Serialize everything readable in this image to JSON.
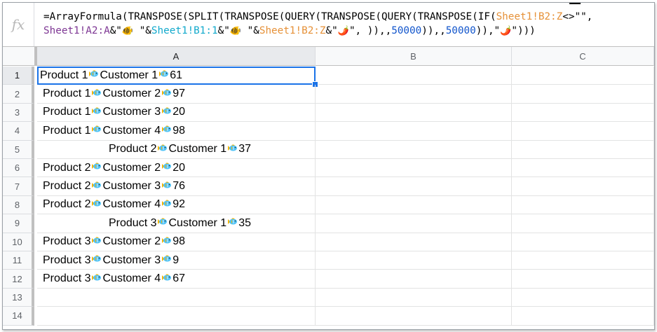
{
  "formula_bar": {
    "fx_label": "fx",
    "formula_segments": [
      {
        "t": "=ArrayFormula(TRANSPOSE(SPLIT(TRANSPOSE(QUERY(TRANSPOSE(QUERY(TRANSPOSE(IF(",
        "c": ""
      },
      {
        "t": "Sheet1!B2:Z",
        "c": "or"
      },
      {
        "t": "<>\"\",",
        "c": ""
      },
      {
        "t": "\n",
        "c": ""
      },
      {
        "t": "Sheet1!A2:A",
        "c": "pu"
      },
      {
        "t": "&\"",
        "c": ""
      },
      {
        "t": "🐠",
        "c": "em"
      },
      {
        "t": " \"&",
        "c": ""
      },
      {
        "t": "Sheet1!B1:1",
        "c": "cy"
      },
      {
        "t": "&\"",
        "c": ""
      },
      {
        "t": "🐠",
        "c": "em"
      },
      {
        "t": " \"&",
        "c": ""
      },
      {
        "t": "Sheet1!B2:Z",
        "c": "or"
      },
      {
        "t": "&\"",
        "c": ""
      },
      {
        "t": "🌶️",
        "c": "em"
      },
      {
        "t": "\", )),,",
        "c": ""
      },
      {
        "t": "50000",
        "c": "bl"
      },
      {
        "t": ")),,",
        "c": ""
      },
      {
        "t": "50000",
        "c": "bl"
      },
      {
        "t": ")),\"",
        "c": ""
      },
      {
        "t": "🌶️",
        "c": "em"
      },
      {
        "t": "\")))",
        "c": ""
      }
    ]
  },
  "columns": [
    "A",
    "B",
    "C"
  ],
  "rows": [
    {
      "num": "1",
      "product": "Product 1",
      "customer": "Customer 1",
      "value": "61",
      "align": "left"
    },
    {
      "num": "2",
      "product": "Product 1",
      "customer": "Customer 2",
      "value": "97",
      "align": "left"
    },
    {
      "num": "3",
      "product": "Product 1",
      "customer": "Customer 3",
      "value": "20",
      "align": "left"
    },
    {
      "num": "4",
      "product": "Product 1",
      "customer": "Customer 4",
      "value": "98",
      "align": "left"
    },
    {
      "num": "5",
      "product": "Product 2",
      "customer": "Customer 1",
      "value": "37",
      "align": "center"
    },
    {
      "num": "6",
      "product": "Product 2",
      "customer": "Customer 2",
      "value": "20",
      "align": "left"
    },
    {
      "num": "7",
      "product": "Product 2",
      "customer": "Customer 3",
      "value": "76",
      "align": "left"
    },
    {
      "num": "8",
      "product": "Product 2",
      "customer": "Customer 4",
      "value": "92",
      "align": "left"
    },
    {
      "num": "9",
      "product": "Product 3",
      "customer": "Customer 1",
      "value": "35",
      "align": "center"
    },
    {
      "num": "10",
      "product": "Product 3",
      "customer": "Customer 2",
      "value": "98",
      "align": "left"
    },
    {
      "num": "11",
      "product": "Product 3",
      "customer": "Customer 3",
      "value": "9",
      "align": "left"
    },
    {
      "num": "12",
      "product": "Product 3",
      "customer": "Customer 4",
      "value": "67",
      "align": "left"
    },
    {
      "num": "13"
    },
    {
      "num": "14"
    }
  ],
  "selected_cell": "A1",
  "colors": {
    "accent": "#1a73e8",
    "range_orange": "#e69138",
    "range_purple": "#7e3794",
    "range_cyan": "#11a9cc",
    "number_blue": "#1155cc"
  },
  "icons": {
    "separator_icon": "tropical-fish-icon",
    "delimiter_icon": "chili-pepper-icon"
  }
}
